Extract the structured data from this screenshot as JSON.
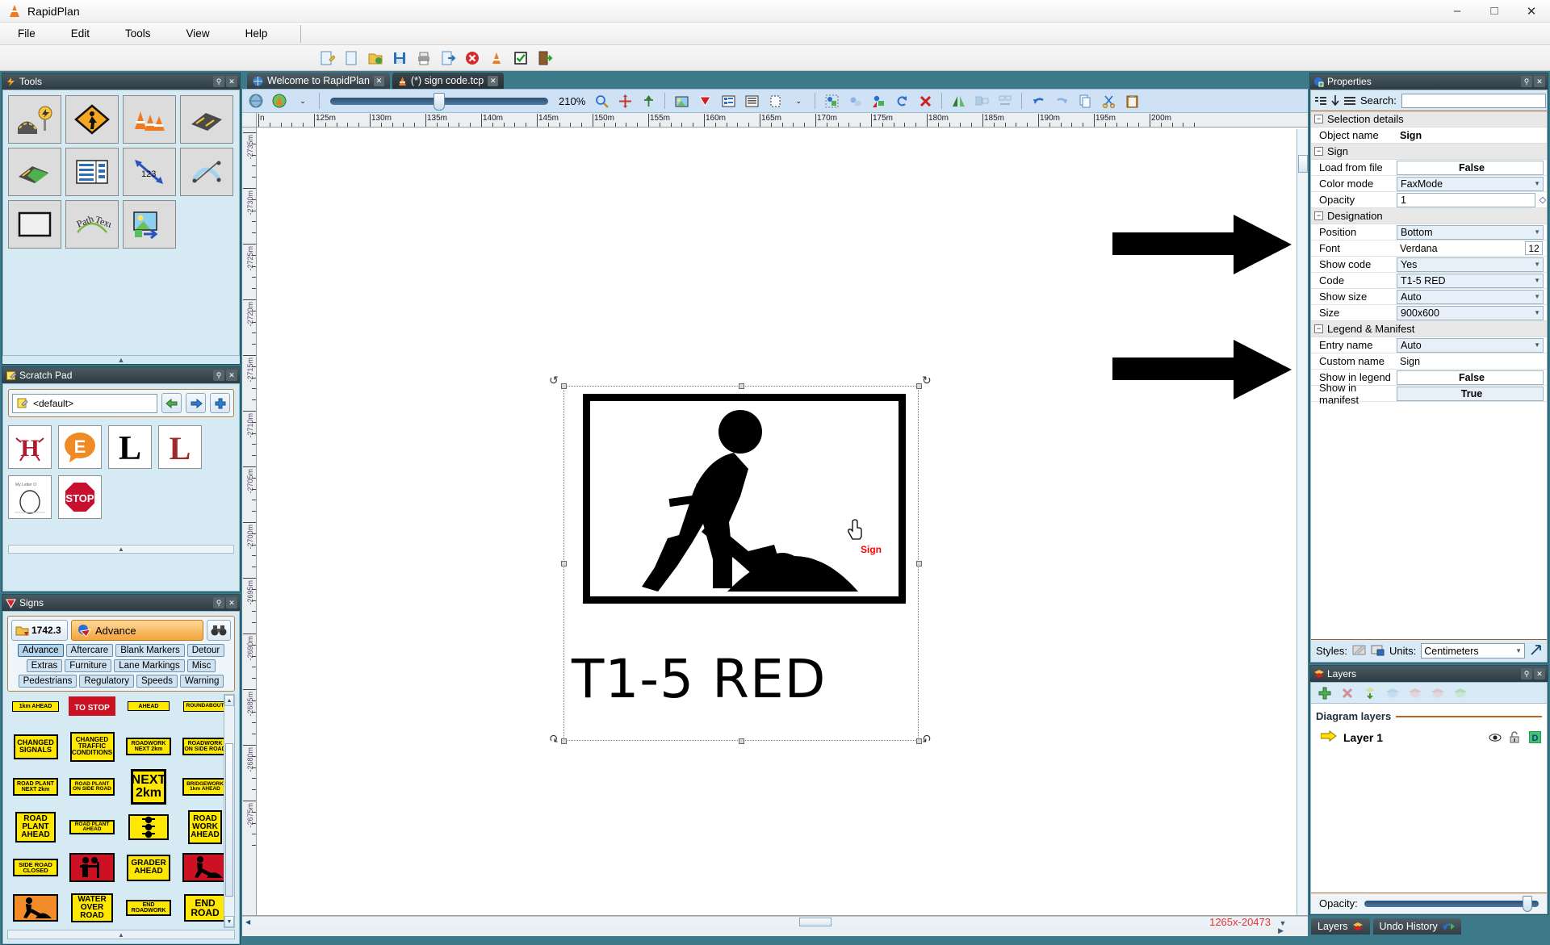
{
  "window": {
    "title": "RapidPlan",
    "icon": "rapidplan-cone-icon",
    "minimize": "–",
    "maximize": "□",
    "close": "✕"
  },
  "menu": {
    "items": [
      "File",
      "Edit",
      "Tools",
      "View",
      "Help"
    ]
  },
  "main_toolbar": {
    "icons": [
      "new-wizard-icon",
      "new-file-icon",
      "open-folder-icon",
      "save-icon",
      "print-icon",
      "export-icon",
      "delete-icon",
      "cone-tool-icon",
      "check-icon",
      "exit-icon"
    ]
  },
  "tools_panel": {
    "title": "Tools",
    "icon": "tools-lightning-icon",
    "pin": "pin-icon",
    "close": "close-icon",
    "items": [
      {
        "name": "road-sign-tool",
        "label": "Road"
      },
      {
        "name": "warning-sign-tool",
        "label": "Sign"
      },
      {
        "name": "cones-tool",
        "label": "Cones"
      },
      {
        "name": "road-surface-tool",
        "label": "Surface"
      },
      {
        "name": "mesh-road-tool",
        "label": "Mesh"
      },
      {
        "name": "legend-table-tool",
        "label": "Legend"
      },
      {
        "name": "dimension-tool",
        "label": "123"
      },
      {
        "name": "curve-tool",
        "label": "Curve"
      },
      {
        "name": "shape-tool",
        "label": "Shape"
      },
      {
        "name": "path-text-tool",
        "label": "Path Text"
      },
      {
        "name": "image-tool",
        "label": "Image"
      }
    ],
    "collapse_handle": "▲"
  },
  "scratch_pad": {
    "title": "Scratch Pad",
    "icon": "notepad-icon",
    "selected_set": "<default>",
    "set_icon": "notepad-icon",
    "prev": "←",
    "next": "→",
    "add": "+",
    "items": [
      {
        "name": "thumb-letter-h",
        "label": "H"
      },
      {
        "name": "thumb-letter-e",
        "label": "E"
      },
      {
        "name": "thumb-letter-l",
        "label": "L"
      },
      {
        "name": "thumb-letter-l2",
        "label": "L"
      },
      {
        "name": "thumb-letter-o",
        "label": "O"
      },
      {
        "name": "thumb-stop-sign",
        "label": "STOP"
      }
    ],
    "collapse_handle": "▲"
  },
  "signs_panel": {
    "title": "Signs",
    "icon": "signs-triangle-icon",
    "library_count": "1742.3",
    "library_icon": "folder-icon",
    "category": "Advance",
    "category_icon": "category-sphere-icon",
    "search_icon": "binoculars-icon",
    "tags": [
      "Advance",
      "Aftercare",
      "Blank Markers",
      "Detour",
      "Extras",
      "Furniture",
      "Lane Markings",
      "Misc",
      "Pedestrians",
      "Regulatory",
      "Speeds",
      "Warning"
    ],
    "selected_tag": "Advance",
    "sign_items": [
      {
        "text": "1km AHEAD",
        "style": "yellow",
        "size": "tiny"
      },
      {
        "text": "TO STOP",
        "style": "red",
        "size": "small"
      },
      {
        "text": "AHEAD",
        "style": "yellow",
        "size": "tiny"
      },
      {
        "text": "ROUNDABOUT",
        "style": "yellow",
        "size": "tiny"
      },
      {
        "text": "CHANGED SIGNALS",
        "style": "yellow",
        "size": "med"
      },
      {
        "text": "CHANGED TRAFFIC CONDITIONS",
        "style": "yellow",
        "size": "med"
      },
      {
        "text": "ROADWORK NEXT 2km",
        "style": "yellow",
        "size": "small"
      },
      {
        "text": "ROADWORK ON SIDE ROAD",
        "style": "yellow",
        "size": "small"
      },
      {
        "text": "ROAD PLANT NEXT 2km",
        "style": "yellow",
        "size": "small"
      },
      {
        "text": "ROAD PLANT ON SIDE ROAD",
        "style": "yellow",
        "size": "small"
      },
      {
        "text": "NEXT 2km",
        "style": "yellow",
        "size": "big"
      },
      {
        "text": "BRIDGEWORK 1km AHEAD",
        "style": "yellow",
        "size": "small"
      },
      {
        "text": "ROAD PLANT AHEAD",
        "style": "yellow",
        "size": "med"
      },
      {
        "text": "ROAD PLANT AHEAD",
        "style": "yellow",
        "size": "tiny"
      },
      {
        "text": "traffic-signal-symbol",
        "style": "yellow",
        "size": "sym"
      },
      {
        "text": "ROAD WORK AHEAD",
        "style": "yellow",
        "size": "med"
      },
      {
        "text": "SIDE ROAD CLOSED",
        "style": "yellow",
        "size": "small"
      },
      {
        "text": "workers-symbol",
        "style": "red",
        "size": "sym"
      },
      {
        "text": "GRADER AHEAD",
        "style": "yellow",
        "size": "med"
      },
      {
        "text": "digger-symbol",
        "style": "red",
        "size": "sym"
      },
      {
        "text": "digger-symbol-orange",
        "style": "org",
        "size": "sym"
      },
      {
        "text": "WATER OVER ROAD",
        "style": "yellow",
        "size": "med"
      },
      {
        "text": "END ROADWORK",
        "style": "yellow",
        "size": "small"
      },
      {
        "text": "END ROAD",
        "style": "yellow",
        "size": "med"
      }
    ],
    "scroll_up": "▲",
    "scroll_down": "▼",
    "hscroll_handle": "▲"
  },
  "tabs": [
    {
      "label": "Welcome to RapidPlan",
      "icon": "welcome-icon",
      "close": "✕",
      "active": false
    },
    {
      "label": "(*) sign code.tcp",
      "icon": "cone-icon",
      "close": "✕",
      "active": true
    }
  ],
  "doc_toolbar": {
    "zoom_value": "210%",
    "icons_left": [
      "globe-icon",
      "worksite-icon",
      "chevron-down-icon"
    ],
    "icons_right": [
      "zoom-magnifier-icon",
      "move-icon",
      "pin-point-icon",
      "image-icon",
      "sign-filter-icon",
      "legend-icon",
      "manifest-icon",
      "page-icon",
      "chevron-down-icon",
      "select-region-icon",
      "group-icon",
      "ungroup-icon",
      "rotate-icon",
      "delete-red-icon",
      "mirror-icon",
      "align-icon",
      "distribute-icon",
      "undo-icon",
      "redo-icon",
      "copy-icon",
      "cut-icon",
      "paste-icon"
    ]
  },
  "ruler": {
    "h_labels": [
      "n",
      "125m",
      "130m",
      "135m",
      "140m",
      "145m",
      "150m",
      "155m",
      "160m",
      "165m",
      "170m",
      "175m",
      "180m",
      "185m",
      "190m",
      "195m",
      "200m"
    ],
    "v_labels": [
      "-2735m",
      "-2730m",
      "-2725m",
      "-2720m",
      "-2715m",
      "-2710m",
      "-2705m",
      "-2700m",
      "-2695m",
      "-2690m",
      "-2685m",
      "-2680m",
      "-2675m"
    ]
  },
  "canvas": {
    "selected_object_label": "Sign",
    "sign_code_text": "T1-5 RED",
    "cursor": "pointing-hand-cursor",
    "rotate_handle": "↺",
    "arrow_annotations": 2
  },
  "statusbar": {
    "coordinates": "1265x-20473",
    "dropdown": "▼",
    "scroll_right": "▶"
  },
  "properties": {
    "title": "Properties",
    "icon": "properties-icon",
    "pin": "pin-icon",
    "close": "close-icon",
    "toolbar_icons": [
      "categorized-icon",
      "sort-icon",
      "alphabetical-icon"
    ],
    "search_label": "Search:",
    "search_value": "",
    "groups": [
      {
        "name": "Selection details",
        "rows": [
          {
            "label": "Object name",
            "value": "Sign",
            "type": "plain-bold"
          }
        ]
      },
      {
        "name": "Sign",
        "rows": [
          {
            "label": "Load from file",
            "value": "False",
            "type": "toggle"
          },
          {
            "label": "Color mode",
            "value": "FaxMode",
            "type": "combo"
          },
          {
            "label": "Opacity",
            "value": "1",
            "type": "spin"
          }
        ]
      },
      {
        "name": "Designation",
        "rows": [
          {
            "label": "Position",
            "value": "Bottom",
            "type": "combo"
          },
          {
            "label": "Font",
            "value": "Verdana",
            "type": "font",
            "extra": "12"
          },
          {
            "label": "Show code",
            "value": "Yes",
            "type": "combo"
          },
          {
            "label": "Code",
            "value": "T1-5 RED",
            "type": "combo"
          },
          {
            "label": "Show size",
            "value": "Auto",
            "type": "combo"
          },
          {
            "label": "Size",
            "value": "900x600",
            "type": "combo"
          }
        ]
      },
      {
        "name": "Legend & Manifest",
        "rows": [
          {
            "label": "Entry name",
            "value": "Auto",
            "type": "combo"
          },
          {
            "label": "Custom name",
            "value": "Sign",
            "type": "text"
          },
          {
            "label": "Show in legend",
            "value": "False",
            "type": "toggle"
          },
          {
            "label": "Show in manifest",
            "value": "True",
            "type": "toggle-on"
          }
        ]
      }
    ],
    "footer": {
      "styles_label": "Styles:",
      "style_icons": [
        "style-brush-icon",
        "style-save-icon"
      ],
      "units_label": "Units:",
      "units_value": "Centimeters",
      "expand_icon": "expand-icon"
    }
  },
  "layers": {
    "title": "Layers",
    "icon": "layers-icon",
    "pin": "pin-icon",
    "close": "close-icon",
    "tools": [
      "add-layer-icon",
      "delete-layer-icon",
      "import-layer-icon",
      "move-up-layer-icon",
      "move-down-layer-icon",
      "merge-layer-icon",
      "duplicate-layer-icon"
    ],
    "section_title": "Diagram layers",
    "items": [
      {
        "name": "Layer 1",
        "arrow": "active-layer-arrow-icon",
        "visible": "eye-icon",
        "lock": "unlock-icon",
        "diagram": "diagram-badge-icon"
      }
    ],
    "opacity_label": "Opacity:",
    "opacity_value": 100
  },
  "bottom_tabs": [
    {
      "label": "Layers",
      "icon": "layers-icon"
    },
    {
      "label": "Undo History",
      "icon": "undo-history-icon"
    }
  ],
  "colors": {
    "accent_teal": "#3c7a8a",
    "panel_blue": "#d6eaf4",
    "sign_yellow": "#ffe800",
    "sign_red": "#cc1122",
    "coord_red": "#e8302e",
    "category_orange": "#f3a43c"
  }
}
